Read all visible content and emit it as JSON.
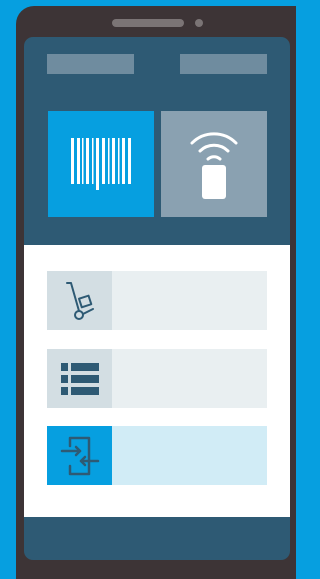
{
  "colors": {
    "background": "#069fe0",
    "phone_body": "#3d3436",
    "screen_header": "#2e5a74",
    "accent": "#069fe0",
    "tile_muted": "#8aa1b1",
    "row_bg": "#e9eff1",
    "row_icon_bg": "#d3dee3",
    "row_active_bg": "#d1ecf6"
  },
  "header": {
    "left_placeholder": "",
    "right_placeholder": ""
  },
  "tiles": [
    {
      "icon": "barcode-icon",
      "label": ""
    },
    {
      "icon": "rfid-tag-icon",
      "label": ""
    }
  ],
  "menu": {
    "items": [
      {
        "icon": "hand-truck-icon",
        "label": "",
        "active": false
      },
      {
        "icon": "list-icon",
        "label": "",
        "active": false
      },
      {
        "icon": "transfer-icon",
        "label": "",
        "active": true
      }
    ]
  }
}
